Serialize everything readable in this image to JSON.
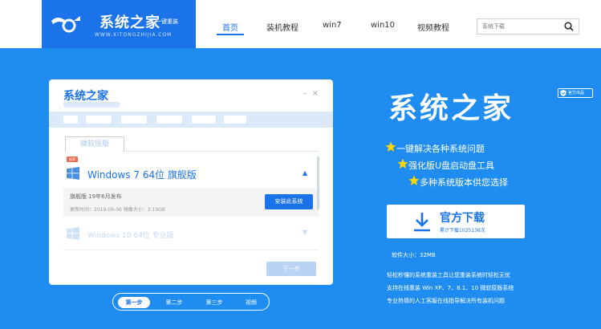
{
  "logo": {
    "title": "系统之家",
    "subtitle": "一键重装",
    "url": "WWW.XITONGZHIJIA.COM"
  },
  "nav": {
    "items": [
      {
        "label": "首页",
        "active": true
      },
      {
        "label": "装机教程",
        "active": false
      },
      {
        "label": "win7",
        "active": false
      },
      {
        "label": "win10",
        "active": false
      },
      {
        "label": "视频教程",
        "active": false
      }
    ]
  },
  "search": {
    "placeholder": "系统下载"
  },
  "window": {
    "title": "系统之家",
    "tab": "微软原版",
    "badge": "推荐",
    "os_primary": "Windows 7 64位 旗舰版",
    "detail_version": "旗舰版 19年6月发布",
    "detail_meta": "更新时间：2019-06-06   镜像大小：3.19GB",
    "install_label": "安装此系统",
    "os_secondary": "Windows 10 64位 专业版",
    "next_label": "下一步"
  },
  "steps": [
    {
      "label": "第一步",
      "active": true
    },
    {
      "label": "第二步",
      "active": false
    },
    {
      "label": "第三步",
      "active": false
    },
    {
      "label": "视频",
      "active": false
    }
  ],
  "hero": {
    "title": "系统之家",
    "official_badge": "官方出品",
    "features": [
      "一键解决各种系统问题",
      "强化版U盘启动盘工具",
      "多种系统版本供您选择"
    ],
    "download_label": "官方下载",
    "download_count": "累计下载1025136次",
    "size": "软件大小：32MB",
    "description": [
      "轻松秒懂的系统重装工具让您重装系统时轻松无忧",
      "支持在线重装 Win XP、7、8.1、10 微软原版系统",
      "专业热情的人工客服在线指导解决所有装机问题"
    ]
  },
  "colors": {
    "brand_blue": "#1a73e8",
    "banner_blue": "#1e8cf0",
    "star_yellow": "#ffd400"
  }
}
